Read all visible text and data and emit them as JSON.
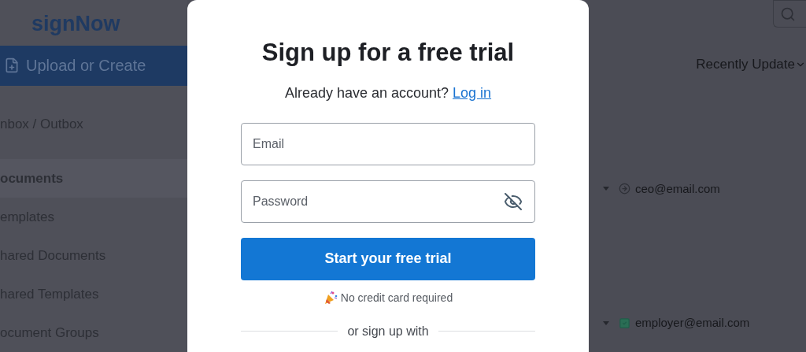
{
  "sidebar": {
    "logo": "signNow",
    "upload_button": "Upload or Create",
    "nav": [
      {
        "label": "nbox / Outbox",
        "selected": false
      },
      {
        "label": "ocuments",
        "selected": true
      },
      {
        "label": "emplates",
        "selected": false
      },
      {
        "label": "hared Documents",
        "selected": false
      },
      {
        "label": "hared Templates",
        "selected": false
      },
      {
        "label": "ocument Groups",
        "selected": false
      }
    ]
  },
  "modal": {
    "title": "Sign up for a free trial",
    "prompt": "Already have an account?",
    "login_link": "Log in",
    "email_placeholder": "Email",
    "password_placeholder": "Password",
    "password_visible": false,
    "submit": "Start your free trial",
    "note": "No credit card required",
    "divider": "or sign up with"
  },
  "main": {
    "sort": "Recently Update",
    "rows": [
      {
        "email": "ceo@email.com",
        "kind": "sent"
      },
      {
        "email": "employer@email.com",
        "kind": "signed"
      }
    ]
  }
}
